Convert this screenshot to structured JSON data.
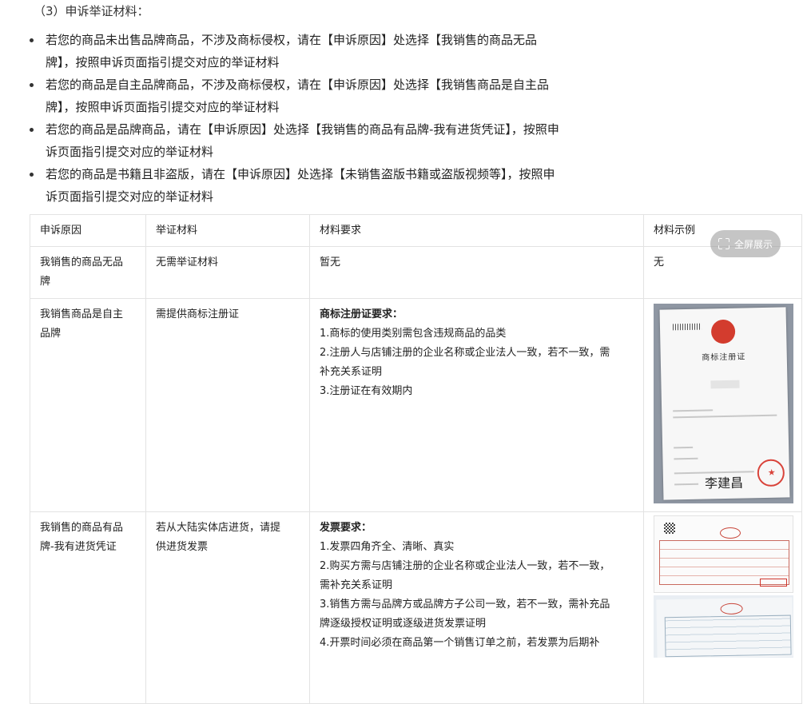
{
  "section_title": "（3）申诉举证材料：",
  "bullets": [
    {
      "line1": "若您的商品未出售品牌商品，不涉及商标侵权，请在【申诉原因】处选择【我销售的商品无品",
      "line2": "牌】，按照申诉页面指引提交对应的举证材料"
    },
    {
      "line1": "若您的商品是自主品牌商品，不涉及商标侵权，请在【申诉原因】处选择【我销售商品是自主品",
      "line2": "牌】，按照申诉页面指引提交对应的举证材料"
    },
    {
      "line1": "若您的商品是品牌商品，请在【申诉原因】处选择【我销售的商品有品牌-我有进货凭证】，按照申",
      "line2": "诉页面指引提交对应的举证材料"
    },
    {
      "line1": "若您的商品是书籍且非盗版，请在【申诉原因】处选择【未销售盗版书籍或盗版视频等】，按照申",
      "line2": "诉页面指引提交对应的举证材料"
    }
  ],
  "table": {
    "headers": [
      "申诉原因",
      "举证材料",
      "材料要求",
      "材料示例"
    ],
    "rows": [
      {
        "reason_l1": "我销售的商品无品",
        "reason_l2": "牌",
        "evidence_l1": "无需举证材料",
        "evidence_l2": "",
        "req_title": "",
        "req_lines": [
          "暂无"
        ],
        "example_text": "无"
      },
      {
        "reason_l1": "我销售商品是自主",
        "reason_l2": "品牌",
        "evidence_l1": "需提供商标注册证",
        "evidence_l2": "",
        "req_title": "商标注册证要求：",
        "req_lines": [
          "1.商标的使用类别需包含违规商品的品类",
          "2.注册人与店铺注册的企业名称或企业法人一致，若不一致，需",
          "补充关系证明",
          "3.注册证在有效期内"
        ],
        "example_text": ""
      },
      {
        "reason_l1": "我销售的商品有品",
        "reason_l2": "牌-我有进货凭证",
        "evidence_l1": "若从大陆实体店进货，请提",
        "evidence_l2": "供进货发票",
        "req_title": "发票要求：",
        "req_lines": [
          "1.发票四角齐全、清晰、真实",
          "2.购买方需与店铺注册的企业名称或企业法人一致，若不一致，",
          "需补充关系证明",
          "3.销售方需与品牌方或品牌方子公司一致，若不一致，需补充品",
          "牌逐级授权证明或逐级进货发票证明",
          "4.开票时间必须在商品第一个销售订单之前，若发票为后期补"
        ],
        "example_text": ""
      }
    ]
  },
  "fullscreen_label": "全屏展示",
  "certificate_image": {
    "title": "商标注册证",
    "signature": "李建昌"
  }
}
